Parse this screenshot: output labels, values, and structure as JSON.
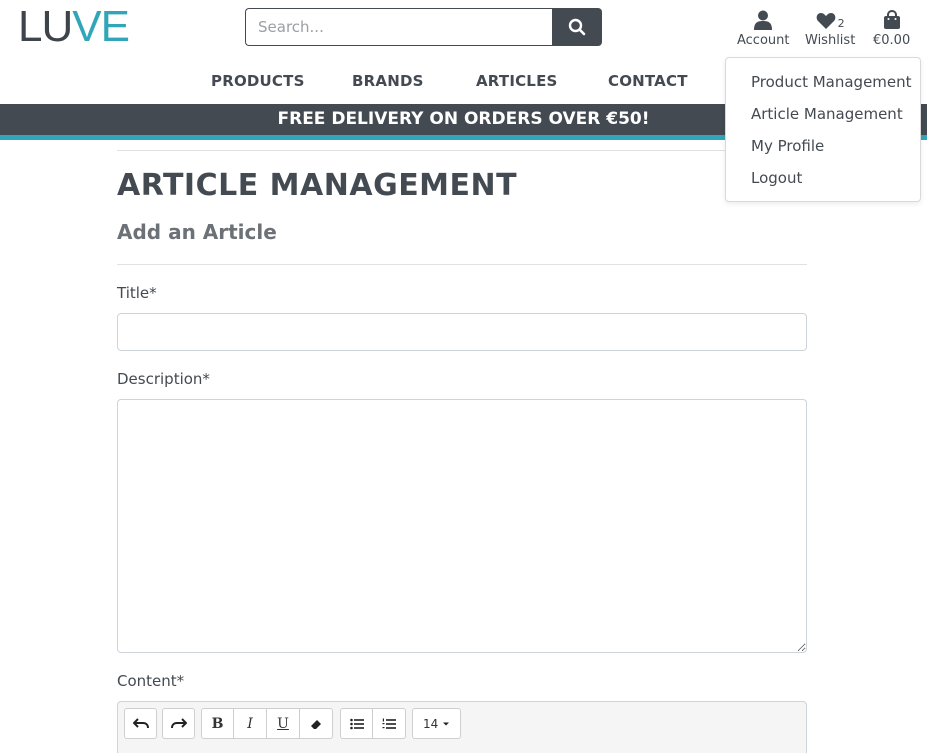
{
  "header": {
    "logo": {
      "part1": "LU",
      "part2": "VE"
    },
    "search": {
      "placeholder": "Search..."
    },
    "account_label": "Account",
    "wishlist_label": "Wishlist",
    "wishlist_count": "2",
    "bag_total": "€0.00"
  },
  "nav": {
    "items": [
      "PRODUCTS",
      "BRANDS",
      "ARTICLES",
      "CONTACT"
    ]
  },
  "banner": {
    "text": "FREE DELIVERY ON ORDERS OVER €50!"
  },
  "account_menu": {
    "items": [
      "Product Management",
      "Article Management",
      "My Profile",
      "Logout"
    ]
  },
  "page": {
    "title": "ARTICLE MANAGEMENT",
    "subtitle": "Add an Article",
    "fields": {
      "title_label": "Title*",
      "description_label": "Description*",
      "content_label": "Content*"
    }
  },
  "editor": {
    "font_size": "14"
  },
  "colors": {
    "dark": "#444a52",
    "accent": "#31a6b8",
    "border": "#ced4da"
  }
}
